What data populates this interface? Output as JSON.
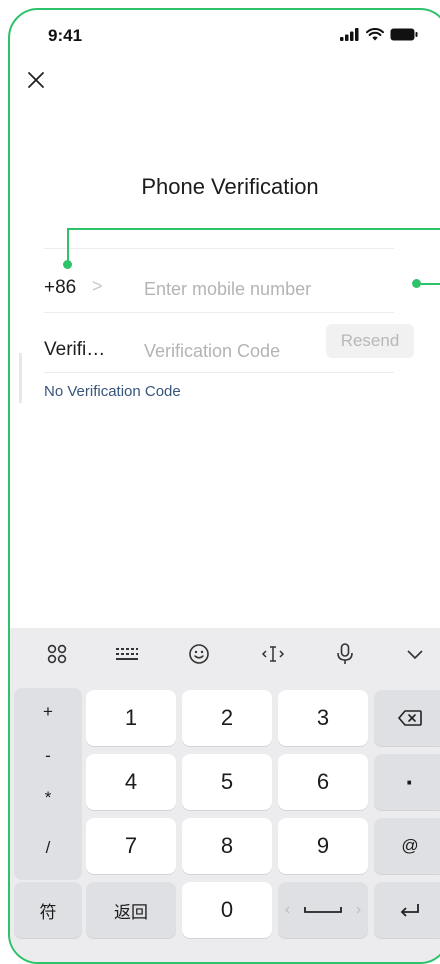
{
  "status_bar": {
    "time": "9:41"
  },
  "header": {
    "title": "Phone Verification"
  },
  "phone": {
    "country_code": "+86",
    "chevron": ">",
    "placeholder": "Enter mobile number"
  },
  "verification": {
    "label": "Verifi…",
    "placeholder": "Verification Code",
    "resend_label": "Resend"
  },
  "no_code_link": "No Verification Code",
  "keyboard": {
    "symbols": [
      "+",
      "-",
      "*",
      "/"
    ],
    "digits_row1": [
      "1",
      "2",
      "3"
    ],
    "digits_row2": [
      "4",
      "5",
      "6"
    ],
    "digits_row3": [
      "7",
      "8",
      "9"
    ],
    "dot": "·",
    "at": "@",
    "fu": "符",
    "fanhui": "返回",
    "zero": "0",
    "toolbar_icons": [
      "apps-icon",
      "keyboard-icon",
      "emoji-icon",
      "cursor-move-icon",
      "microphone-icon",
      "collapse-chevron-icon"
    ]
  },
  "colors": {
    "annotation": "#2ec26a",
    "link": "#36557a"
  }
}
